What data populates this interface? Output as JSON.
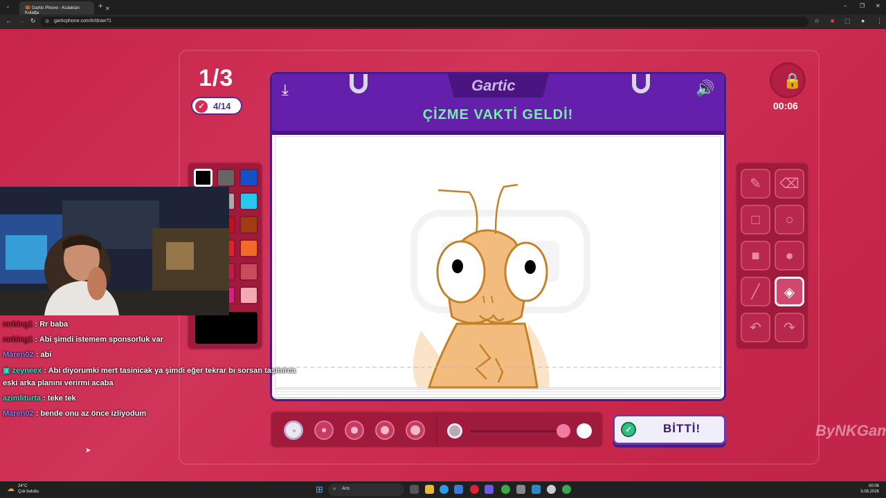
{
  "browser": {
    "tab_title": "Gartic Phone - Kulaktan Kulağa",
    "tab_close": "✕",
    "new_tab": "+",
    "url": "garticphone.com/tr/draw?1",
    "minimize": "–",
    "maximize": "❐",
    "close": "✕"
  },
  "game": {
    "round": "1/3",
    "progress": "4/14",
    "timer": "00:06",
    "logo": "Gartic",
    "title": "ÇİZME VAKTİ GELDİ!",
    "done_button": "BİTTİ!",
    "watermark": "ByNKGame",
    "palette": [
      "#000000",
      "#666666",
      "#1450c8",
      "#ffffff",
      "#aaaaaa",
      "#26c8f0",
      "#8a1010",
      "#c80f0f",
      "#a03c12",
      "#c81010",
      "#e82020",
      "#f06a28",
      "#7a1430",
      "#c81a4a",
      "#c84c5a",
      "#c80a5a",
      "#e01a8a",
      "#f4a8b0"
    ],
    "current_color": "#000000",
    "brush_sizes": [
      1,
      2,
      3,
      4,
      5
    ],
    "selected_brush_size": 1,
    "opacity": 1,
    "selected_tool": "fill",
    "tools": [
      "pencil",
      "eraser",
      "rectangle-outline",
      "ellipse-outline",
      "rectangle-fill",
      "ellipse-fill",
      "line",
      "fill",
      "undo",
      "redo"
    ]
  },
  "chat": [
    {
      "user": "mrbing1",
      "text": "Rr baba",
      "color": "#c8183c"
    },
    {
      "user": "mrbing1",
      "text": "Abi şimdi istemem sponsorluk var",
      "color": "#c8183c"
    },
    {
      "user": "Maren02",
      "text": "abi",
      "color": "#8a80ff"
    },
    {
      "user": "zeyneex",
      "text": "Abi diyorumki mert tasinicak ya şimdi eğer tekrar bı sorsan taşınırca",
      "continuation": "eski arka planını verirmi acaba",
      "color": "#36e0c8"
    },
    {
      "user": "azimliturta",
      "text": "teke tek",
      "color": "#36e0c8"
    },
    {
      "user": "Maren02",
      "text": "bende onu az önce izliyodum",
      "color": "#8a80ff"
    }
  ],
  "taskbar": {
    "weather_temp": "24°C",
    "weather_desc": "Çok bulutlu",
    "search": "Ara",
    "time": "00:06",
    "date": "3.08.2026"
  }
}
